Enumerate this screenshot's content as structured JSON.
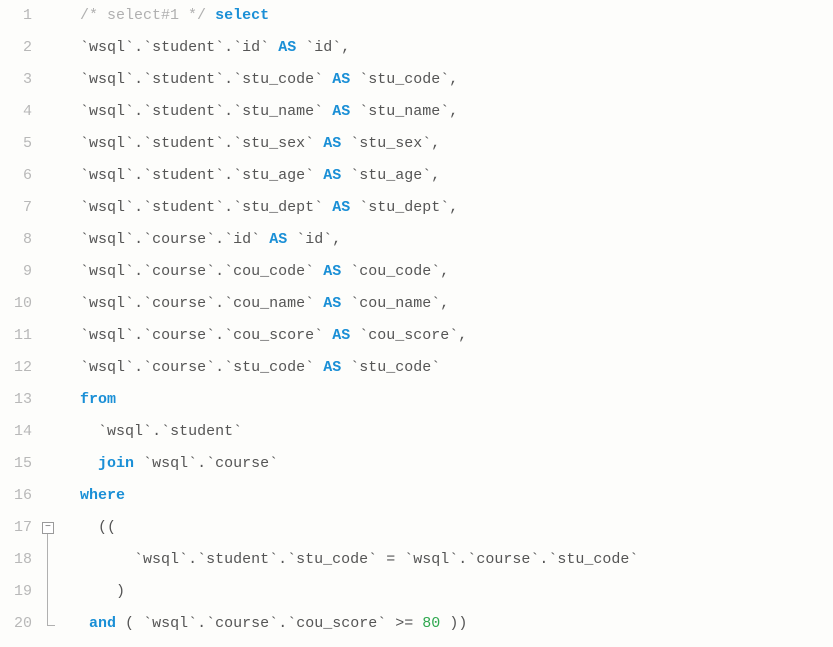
{
  "gutter": {
    "l1": "1",
    "l2": "2",
    "l3": "3",
    "l4": "4",
    "l5": "5",
    "l6": "6",
    "l7": "7",
    "l8": "8",
    "l9": "9",
    "l10": "10",
    "l11": "11",
    "l12": "12",
    "l13": "13",
    "l14": "14",
    "l15": "15",
    "l16": "16",
    "l17": "17",
    "l18": "18",
    "l19": "19",
    "l20": "20"
  },
  "fold": {
    "marker": "−"
  },
  "sql": {
    "comment1": "/* select#1 */",
    "kw": {
      "select": "select",
      "as": "AS",
      "from": "from",
      "join": "join",
      "where": "where",
      "and": "and"
    },
    "db": "wsql",
    "tbl": {
      "student": "student",
      "course": "course"
    },
    "col": {
      "id": "id",
      "stu_code": "stu_code",
      "stu_name": "stu_name",
      "stu_sex": "stu_sex",
      "stu_age": "stu_age",
      "stu_dept": "stu_dept",
      "cou_code": "cou_code",
      "cou_name": "cou_name",
      "cou_score": "cou_score"
    },
    "op": {
      "eq": "=",
      "gte": ">="
    },
    "num": {
      "eighty": "80"
    },
    "p": {
      "bt": "`",
      "dot": ".",
      "comma": ",",
      "open": "(",
      "close": ")",
      "dopen": "((",
      "dclose": "))",
      "sp": " ",
      "sp2": "  ",
      "sp3": "   ",
      "sp4": "    ",
      "sp6": "      ",
      "sp8": "        "
    }
  }
}
